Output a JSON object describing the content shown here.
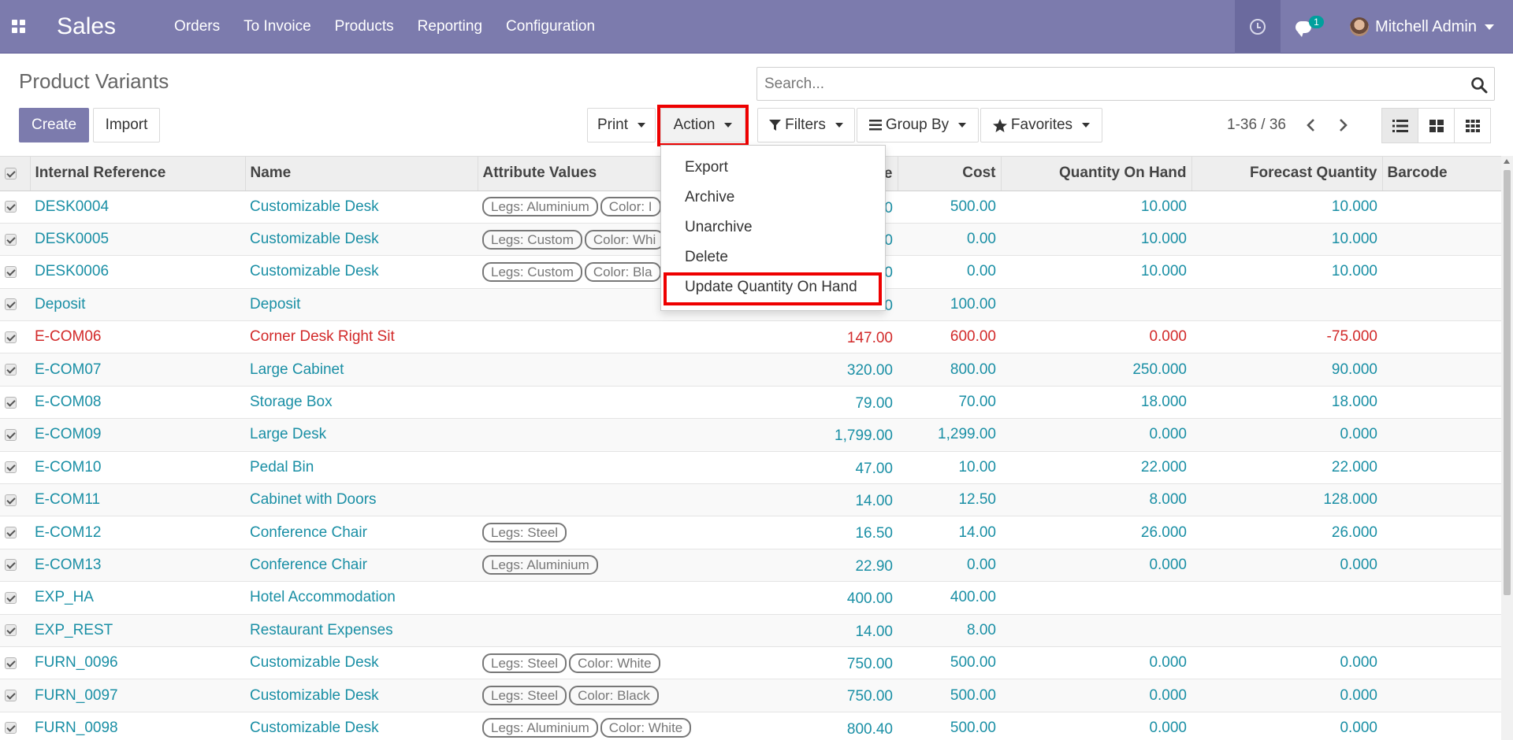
{
  "navbar": {
    "app_name": "Sales",
    "menu": [
      "Orders",
      "To Invoice",
      "Products",
      "Reporting",
      "Configuration"
    ],
    "chat_badge": "1",
    "user_name": "Mitchell Admin"
  },
  "control": {
    "title": "Product Variants",
    "search_placeholder": "Search...",
    "create_label": "Create",
    "import_label": "Import",
    "print_label": "Print",
    "action_label": "Action",
    "filters_label": "Filters",
    "groupby_label": "Group By",
    "favorites_label": "Favorites",
    "pager": "1-36 / 36"
  },
  "action_menu": {
    "items": [
      "Export",
      "Archive",
      "Unarchive",
      "Delete",
      "Update Quantity On Hand"
    ]
  },
  "table": {
    "columns": [
      "Internal Reference",
      "Name",
      "Attribute Values",
      "e",
      "Cost",
      "Quantity On Hand",
      "Forecast Quantity",
      "Barcode"
    ],
    "rows": [
      {
        "ref": "DESK0004",
        "name": "Customizable Desk",
        "tags": [
          "Legs: Aluminium",
          "Color: I"
        ],
        "price": "0",
        "cost": "500.00",
        "qty": "10.000",
        "forecast": "10.000",
        "danger": false
      },
      {
        "ref": "DESK0005",
        "name": "Customizable Desk",
        "tags": [
          "Legs: Custom",
          "Color: Whi"
        ],
        "price": "0",
        "cost": "0.00",
        "qty": "10.000",
        "forecast": "10.000",
        "danger": false
      },
      {
        "ref": "DESK0006",
        "name": "Customizable Desk",
        "tags": [
          "Legs: Custom",
          "Color: Bla"
        ],
        "price": "0",
        "cost": "0.00",
        "qty": "10.000",
        "forecast": "10.000",
        "danger": false
      },
      {
        "ref": "Deposit",
        "name": "Deposit",
        "tags": [],
        "price": "0",
        "cost": "100.00",
        "qty": "",
        "forecast": "",
        "danger": false
      },
      {
        "ref": "E-COM06",
        "name": "Corner Desk Right Sit",
        "tags": [],
        "price": "147.00",
        "cost": "600.00",
        "qty": "0.000",
        "forecast": "-75.000",
        "danger": true
      },
      {
        "ref": "E-COM07",
        "name": "Large Cabinet",
        "tags": [],
        "price": "320.00",
        "cost": "800.00",
        "qty": "250.000",
        "forecast": "90.000",
        "danger": false
      },
      {
        "ref": "E-COM08",
        "name": "Storage Box",
        "tags": [],
        "price": "79.00",
        "cost": "70.00",
        "qty": "18.000",
        "forecast": "18.000",
        "danger": false
      },
      {
        "ref": "E-COM09",
        "name": "Large Desk",
        "tags": [],
        "price": "1,799.00",
        "cost": "1,299.00",
        "qty": "0.000",
        "forecast": "0.000",
        "danger": false
      },
      {
        "ref": "E-COM10",
        "name": "Pedal Bin",
        "tags": [],
        "price": "47.00",
        "cost": "10.00",
        "qty": "22.000",
        "forecast": "22.000",
        "danger": false
      },
      {
        "ref": "E-COM11",
        "name": "Cabinet with Doors",
        "tags": [],
        "price": "14.00",
        "cost": "12.50",
        "qty": "8.000",
        "forecast": "128.000",
        "danger": false
      },
      {
        "ref": "E-COM12",
        "name": "Conference Chair",
        "tags": [
          "Legs: Steel"
        ],
        "price": "16.50",
        "cost": "14.00",
        "qty": "26.000",
        "forecast": "26.000",
        "danger": false
      },
      {
        "ref": "E-COM13",
        "name": "Conference Chair",
        "tags": [
          "Legs: Aluminium"
        ],
        "price": "22.90",
        "cost": "0.00",
        "qty": "0.000",
        "forecast": "0.000",
        "danger": false
      },
      {
        "ref": "EXP_HA",
        "name": "Hotel Accommodation",
        "tags": [],
        "price": "400.00",
        "cost": "400.00",
        "qty": "",
        "forecast": "",
        "danger": false
      },
      {
        "ref": "EXP_REST",
        "name": "Restaurant Expenses",
        "tags": [],
        "price": "14.00",
        "cost": "8.00",
        "qty": "",
        "forecast": "",
        "danger": false
      },
      {
        "ref": "FURN_0096",
        "name": "Customizable Desk",
        "tags": [
          "Legs: Steel",
          "Color: White"
        ],
        "price": "750.00",
        "cost": "500.00",
        "qty": "0.000",
        "forecast": "0.000",
        "danger": false
      },
      {
        "ref": "FURN_0097",
        "name": "Customizable Desk",
        "tags": [
          "Legs: Steel",
          "Color: Black"
        ],
        "price": "750.00",
        "cost": "500.00",
        "qty": "0.000",
        "forecast": "0.000",
        "danger": false
      },
      {
        "ref": "FURN_0098",
        "name": "Customizable Desk",
        "tags": [
          "Legs: Aluminium",
          "Color: White"
        ],
        "price": "800.40",
        "cost": "500.00",
        "qty": "0.000",
        "forecast": "0.000",
        "danger": false
      }
    ]
  },
  "colors": {
    "navbar": "#7c7bad",
    "link": "#1a8fa5",
    "danger": "#d22a2a",
    "highlight": "#ee0000"
  }
}
